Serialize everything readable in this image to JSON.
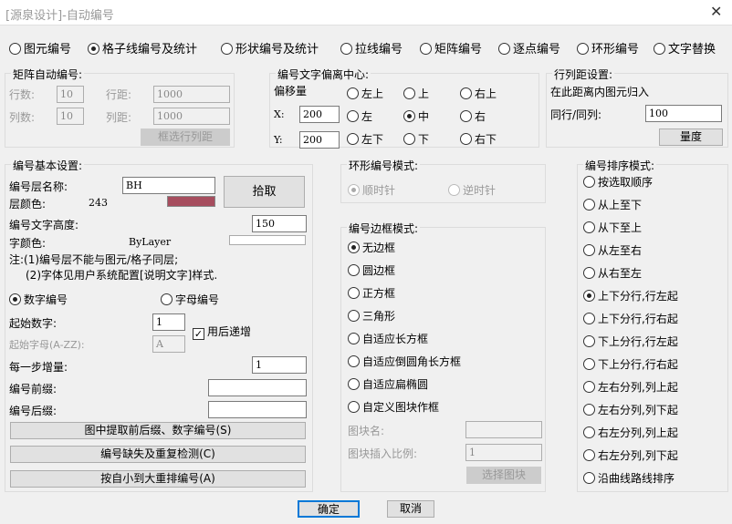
{
  "window": {
    "title": "[源泉设计]-自动编号",
    "close": "✕"
  },
  "modes": [
    {
      "label": "图元编号",
      "checked": false
    },
    {
      "label": "格子线编号及统计",
      "checked": true
    },
    {
      "label": "形状编号及统计",
      "checked": false
    },
    {
      "label": "拉线编号",
      "checked": false
    },
    {
      "label": "矩阵编号",
      "checked": false
    },
    {
      "label": "逐点编号",
      "checked": false
    },
    {
      "label": "环形编号",
      "checked": false
    },
    {
      "label": "文字替换",
      "checked": false
    }
  ],
  "matrix": {
    "title": "矩阵自动编号:",
    "rows_label": "行数:",
    "rows": "10",
    "cols_label": "列数:",
    "cols": "10",
    "row_gap_label": "行距:",
    "row_gap": "1000",
    "col_gap_label": "列距:",
    "col_gap": "1000",
    "select_btn": "框选行列距"
  },
  "offset": {
    "title": "编号文字偏离中心:",
    "amount_label": "偏移量",
    "x_label": "X:",
    "x": "200",
    "y_label": "Y:",
    "y": "200",
    "positions": [
      [
        "左上",
        "上",
        "右上"
      ],
      [
        "左",
        "中",
        "右"
      ],
      [
        "左下",
        "下",
        "右下"
      ]
    ],
    "selected": "中"
  },
  "spacing": {
    "title": "行列距设置:",
    "desc": "在此距离内图元归入",
    "label": "同行/同列:",
    "value": "100",
    "measure_btn": "量度"
  },
  "basic": {
    "title": "编号基本设置:",
    "layer_label": "编号层名称:",
    "layer": "BH",
    "pick_btn": "拾取",
    "layer_color_label": "层颜色:",
    "layer_color": "243",
    "layer_color_hex": "#a64d5e",
    "height_label": "编号文字高度:",
    "height": "150",
    "font_color_label": "字颜色:",
    "font_color": "ByLayer",
    "note1": "注:(1)编号层不能与图元/格子同层;",
    "note2": "(2)字体见用户系统配置[说明文字]样式.",
    "numeric": "数字编号",
    "alpha": "字母编号",
    "start_num_label": "起始数字:",
    "start_num": "1",
    "increment_after": "用后递增",
    "start_letter_label": "起始字母(A-ZZ):",
    "start_letter": "A",
    "step_label": "每一步增量:",
    "step": "1",
    "prefix_label": "编号前缀:",
    "prefix": "",
    "suffix_label": "编号后缀:",
    "suffix": "",
    "btn_extract": "图中提取前后缀、数字编号(S)",
    "btn_check": "编号缺失及重复检测(C)",
    "btn_renumber": "按自小到大重排编号(A)"
  },
  "ring": {
    "title": "环形编号模式:",
    "cw": "顺时针",
    "ccw": "逆时针"
  },
  "border": {
    "title": "编号边框模式:",
    "options": [
      "无边框",
      "圆边框",
      "正方框",
      "三角形",
      "自适应长方框",
      "自适应倒圆角长方框",
      "自适应扁椭圆",
      "自定义图块作框"
    ],
    "selected": 0,
    "block_name_label": "图块名:",
    "block_name": "",
    "block_scale_label": "图块插入比例:",
    "block_scale": "1",
    "select_block": "选择图块"
  },
  "sort": {
    "title": "编号排序模式:",
    "options": [
      "按选取顺序",
      "从上至下",
      "从下至上",
      "从左至右",
      "从右至左",
      "上下分行,行左起",
      "上下分行,行右起",
      "下上分行,行左起",
      "下上分行,行右起",
      "左右分列,列上起",
      "左右分列,列下起",
      "右左分列,列上起",
      "右左分列,列下起",
      "沿曲线路线排序"
    ],
    "selected": 5
  },
  "footer": {
    "ok": "确定",
    "cancel": "取消"
  }
}
